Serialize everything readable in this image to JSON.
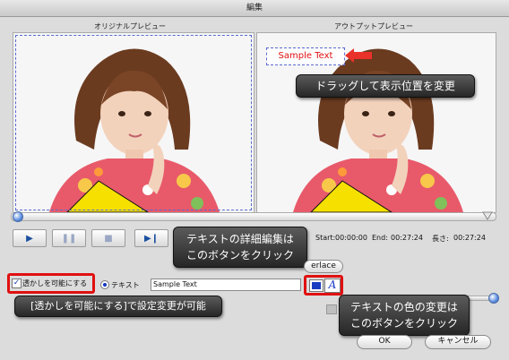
{
  "window": {
    "title": "編集"
  },
  "original_preview": {
    "label": "オリジナルプレビュー"
  },
  "output_preview": {
    "label": "アウトプットプレビュー",
    "sample_text": "Sample Text"
  },
  "playback": {
    "start_label": "Start:",
    "start_value": "00:00:00",
    "end_label": "End:",
    "end_value": "00:27:24",
    "length_label": "長さ:",
    "length_value": "00:27:24",
    "progress": 0
  },
  "interlace": {
    "label": "erlace"
  },
  "watermark": {
    "enable_label": "透かしを可能にする",
    "enable_checked": true,
    "text_option_label": "テキスト",
    "text_value": "Sample Text"
  },
  "callouts": {
    "drag": "ドラッグして表示位置を変更",
    "detail_line1": "テキストの詳細編集は",
    "detail_line2": "このボタンをクリック",
    "enable_note": "[透かしを可能にする]で設定変更が可能",
    "color_line1": "テキストの色の変更は",
    "color_line2": "このボタンをクリック"
  },
  "footer": {
    "ok_label": "OK",
    "cancel_label": "キャンセル"
  },
  "colors": {
    "accent_red": "#e01010",
    "arrow_red": "#e8322a",
    "blue": "#1a3cc0"
  }
}
